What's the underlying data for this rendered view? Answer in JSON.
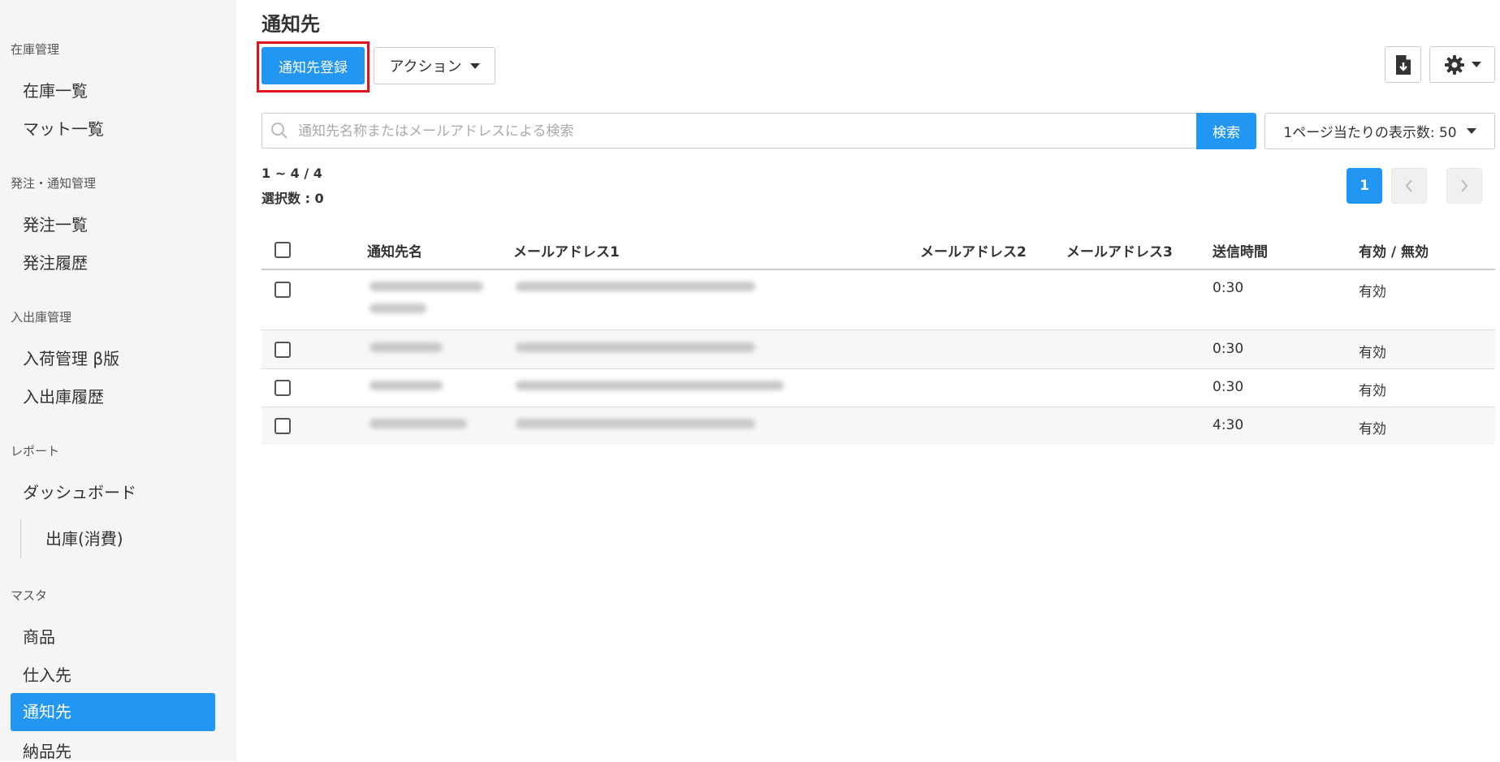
{
  "sidebar": {
    "sections": [
      {
        "title": "在庫管理",
        "items": [
          "在庫一覧",
          "マット一覧"
        ]
      },
      {
        "title": "発注・通知管理",
        "items": [
          "発注一覧",
          "発注履歴"
        ]
      },
      {
        "title": "入出庫管理",
        "items": [
          "入荷管理 β版",
          "入出庫履歴"
        ]
      },
      {
        "title": "レポート",
        "items": [
          "ダッシュボード"
        ],
        "sub_items": [
          "出庫(消費)"
        ]
      },
      {
        "title": "マスタ",
        "items": [
          "商品",
          "仕入先",
          "通知先",
          "納品先"
        ]
      }
    ],
    "active_item": "通知先",
    "accent_color": "#2196f3"
  },
  "header": {
    "title": "通知先",
    "register_label": "通知先登録",
    "action_label": "アクション",
    "export_icon": "file-download-icon",
    "settings_icon": "gear-icon"
  },
  "search": {
    "placeholder": "通知先名称またはメールアドレスによる検索",
    "value": "",
    "button_label": "検索"
  },
  "per_page": {
    "label": "1ページ当たりの表示数: 50"
  },
  "summary": {
    "range": "1 ~ 4 / 4",
    "selected": "選択数 : 0"
  },
  "pagination": {
    "current": "1",
    "prev_icon": "chevron-left-icon",
    "next_icon": "chevron-right-icon"
  },
  "table": {
    "columns": [
      "通知先名",
      "メールアドレス1",
      "メールアドレス2",
      "メールアドレス3",
      "送信時間",
      "有効 / 無効"
    ],
    "rows": [
      {
        "name": "",
        "email1": "",
        "email2": "",
        "email3": "",
        "time": "0:30",
        "status": "有効"
      },
      {
        "name": "",
        "email1": "",
        "email2": "",
        "email3": "",
        "time": "0:30",
        "status": "有効"
      },
      {
        "name": "",
        "email1": "",
        "email2": "",
        "email3": "",
        "time": "0:30",
        "status": "有効"
      },
      {
        "name": "",
        "email1": "",
        "email2": "",
        "email3": "",
        "time": "4:30",
        "status": "有効"
      }
    ]
  }
}
